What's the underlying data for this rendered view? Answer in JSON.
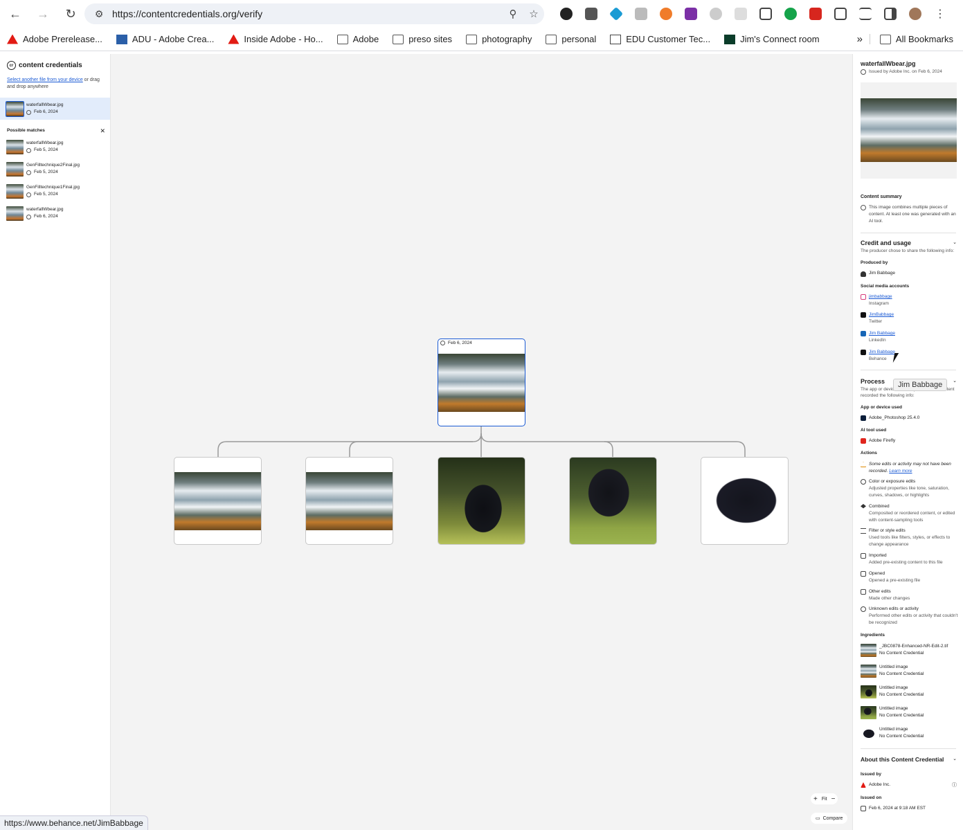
{
  "browser": {
    "url": "https://contentcredentials.org/verify",
    "bookmarks": [
      "Adobe Prerelease...",
      "ADU - Adobe Crea...",
      "Inside Adobe - Ho...",
      "Adobe",
      "preso sites",
      "photography",
      "personal",
      "EDU Customer Tec...",
      "Jim's Connect room"
    ],
    "all_bookmarks": "All Bookmarks",
    "status_url": "https://www.behance.net/JimBabbage"
  },
  "left": {
    "brand": "content credentials",
    "select_link": "Select another file from your device",
    "select_rest": " or drag and drop anywhere",
    "current": {
      "name": "waterfallWbear.jpg",
      "date": "Feb 6, 2024"
    },
    "possible_matches_title": "Possible matches",
    "matches": [
      {
        "name": "waterfallWbear.jpg",
        "date": "Feb 5, 2024"
      },
      {
        "name": "GenFilltechnique2Final.jpg",
        "date": "Feb 5, 2024"
      },
      {
        "name": "GenFilltechnique1Final.jpg",
        "date": "Feb 5, 2024"
      },
      {
        "name": "waterfallWbear.jpg",
        "date": "Feb 6, 2024"
      }
    ]
  },
  "canvas": {
    "root_date": "Feb 6, 2024",
    "zoom_fit": "Fit",
    "compare": "Compare"
  },
  "right": {
    "file_name": "waterfallWbear.jpg",
    "issued_line": "Issued by Adobe Inc. on Feb 6, 2024",
    "content_summary_title": "Content summary",
    "content_summary": "This image combines multiple pieces of content. At least one was generated with an AI tool.",
    "credit_title": "Credit and usage",
    "credit_sub": "The producer chose to share the following info:",
    "produced_by_title": "Produced by",
    "produced_by": "Jim Babbage",
    "social_title": "Social media accounts",
    "social": [
      {
        "name": "jimbabbage",
        "site": "Instagram"
      },
      {
        "name": "JimBabbage",
        "site": "Twitter"
      },
      {
        "name": "Jim Babbage",
        "site": "LinkedIn"
      },
      {
        "name": "Jim Babbage",
        "site": "Behance"
      }
    ],
    "process_title": "Process",
    "process_sub": "The app or device used to produce this content recorded the following info:",
    "app_title": "App or device used",
    "app": "Adobe_Photoshop 25.4.0",
    "ai_title": "AI tool used",
    "ai": "Adobe Firefly",
    "actions_title": "Actions",
    "warning": "Some edits or activity may not have been recorded.",
    "learn_more": "Learn more",
    "actions": [
      {
        "title": "Color or exposure edits",
        "desc": "Adjusted properties like tone, saturation, curves, shadows, or highlights"
      },
      {
        "title": "Combined",
        "desc": "Composited or reordered content, or edited with content-sampling tools"
      },
      {
        "title": "Filter or style edits",
        "desc": "Used tools like filters, styles, or effects to change appearance"
      },
      {
        "title": "Imported",
        "desc": "Added pre-existing content to this file"
      },
      {
        "title": "Opened",
        "desc": "Opened a pre-existing file"
      },
      {
        "title": "Other edits",
        "desc": "Made other changes"
      },
      {
        "title": "Unknown edits or activity",
        "desc": "Performed other edits or activity that couldn't be recognized"
      }
    ],
    "ingredients_title": "Ingredients",
    "ingredients": [
      {
        "name": "_JBC0878-Enhanced-NR-Edit-2.tif",
        "status": "No Content Credential"
      },
      {
        "name": "Untitled image",
        "status": "No Content Credential"
      },
      {
        "name": "Untitled image",
        "status": "No Content Credential"
      },
      {
        "name": "Untitled image",
        "status": "No Content Credential"
      },
      {
        "name": "Untitled image",
        "status": "No Content Credential"
      }
    ],
    "about_title": "About this Content Credential",
    "issued_by_title": "Issued by",
    "issued_by": "Adobe Inc.",
    "issued_on_title": "Issued on",
    "issued_on": "Feb 6, 2024 at 9:18 AM EST"
  },
  "tooltip": "Jim Babbage",
  "colors": {
    "accent": "#1a5ad4",
    "selected_bg": "#e2ecfb",
    "canvas_bg": "#f3f3f3"
  }
}
